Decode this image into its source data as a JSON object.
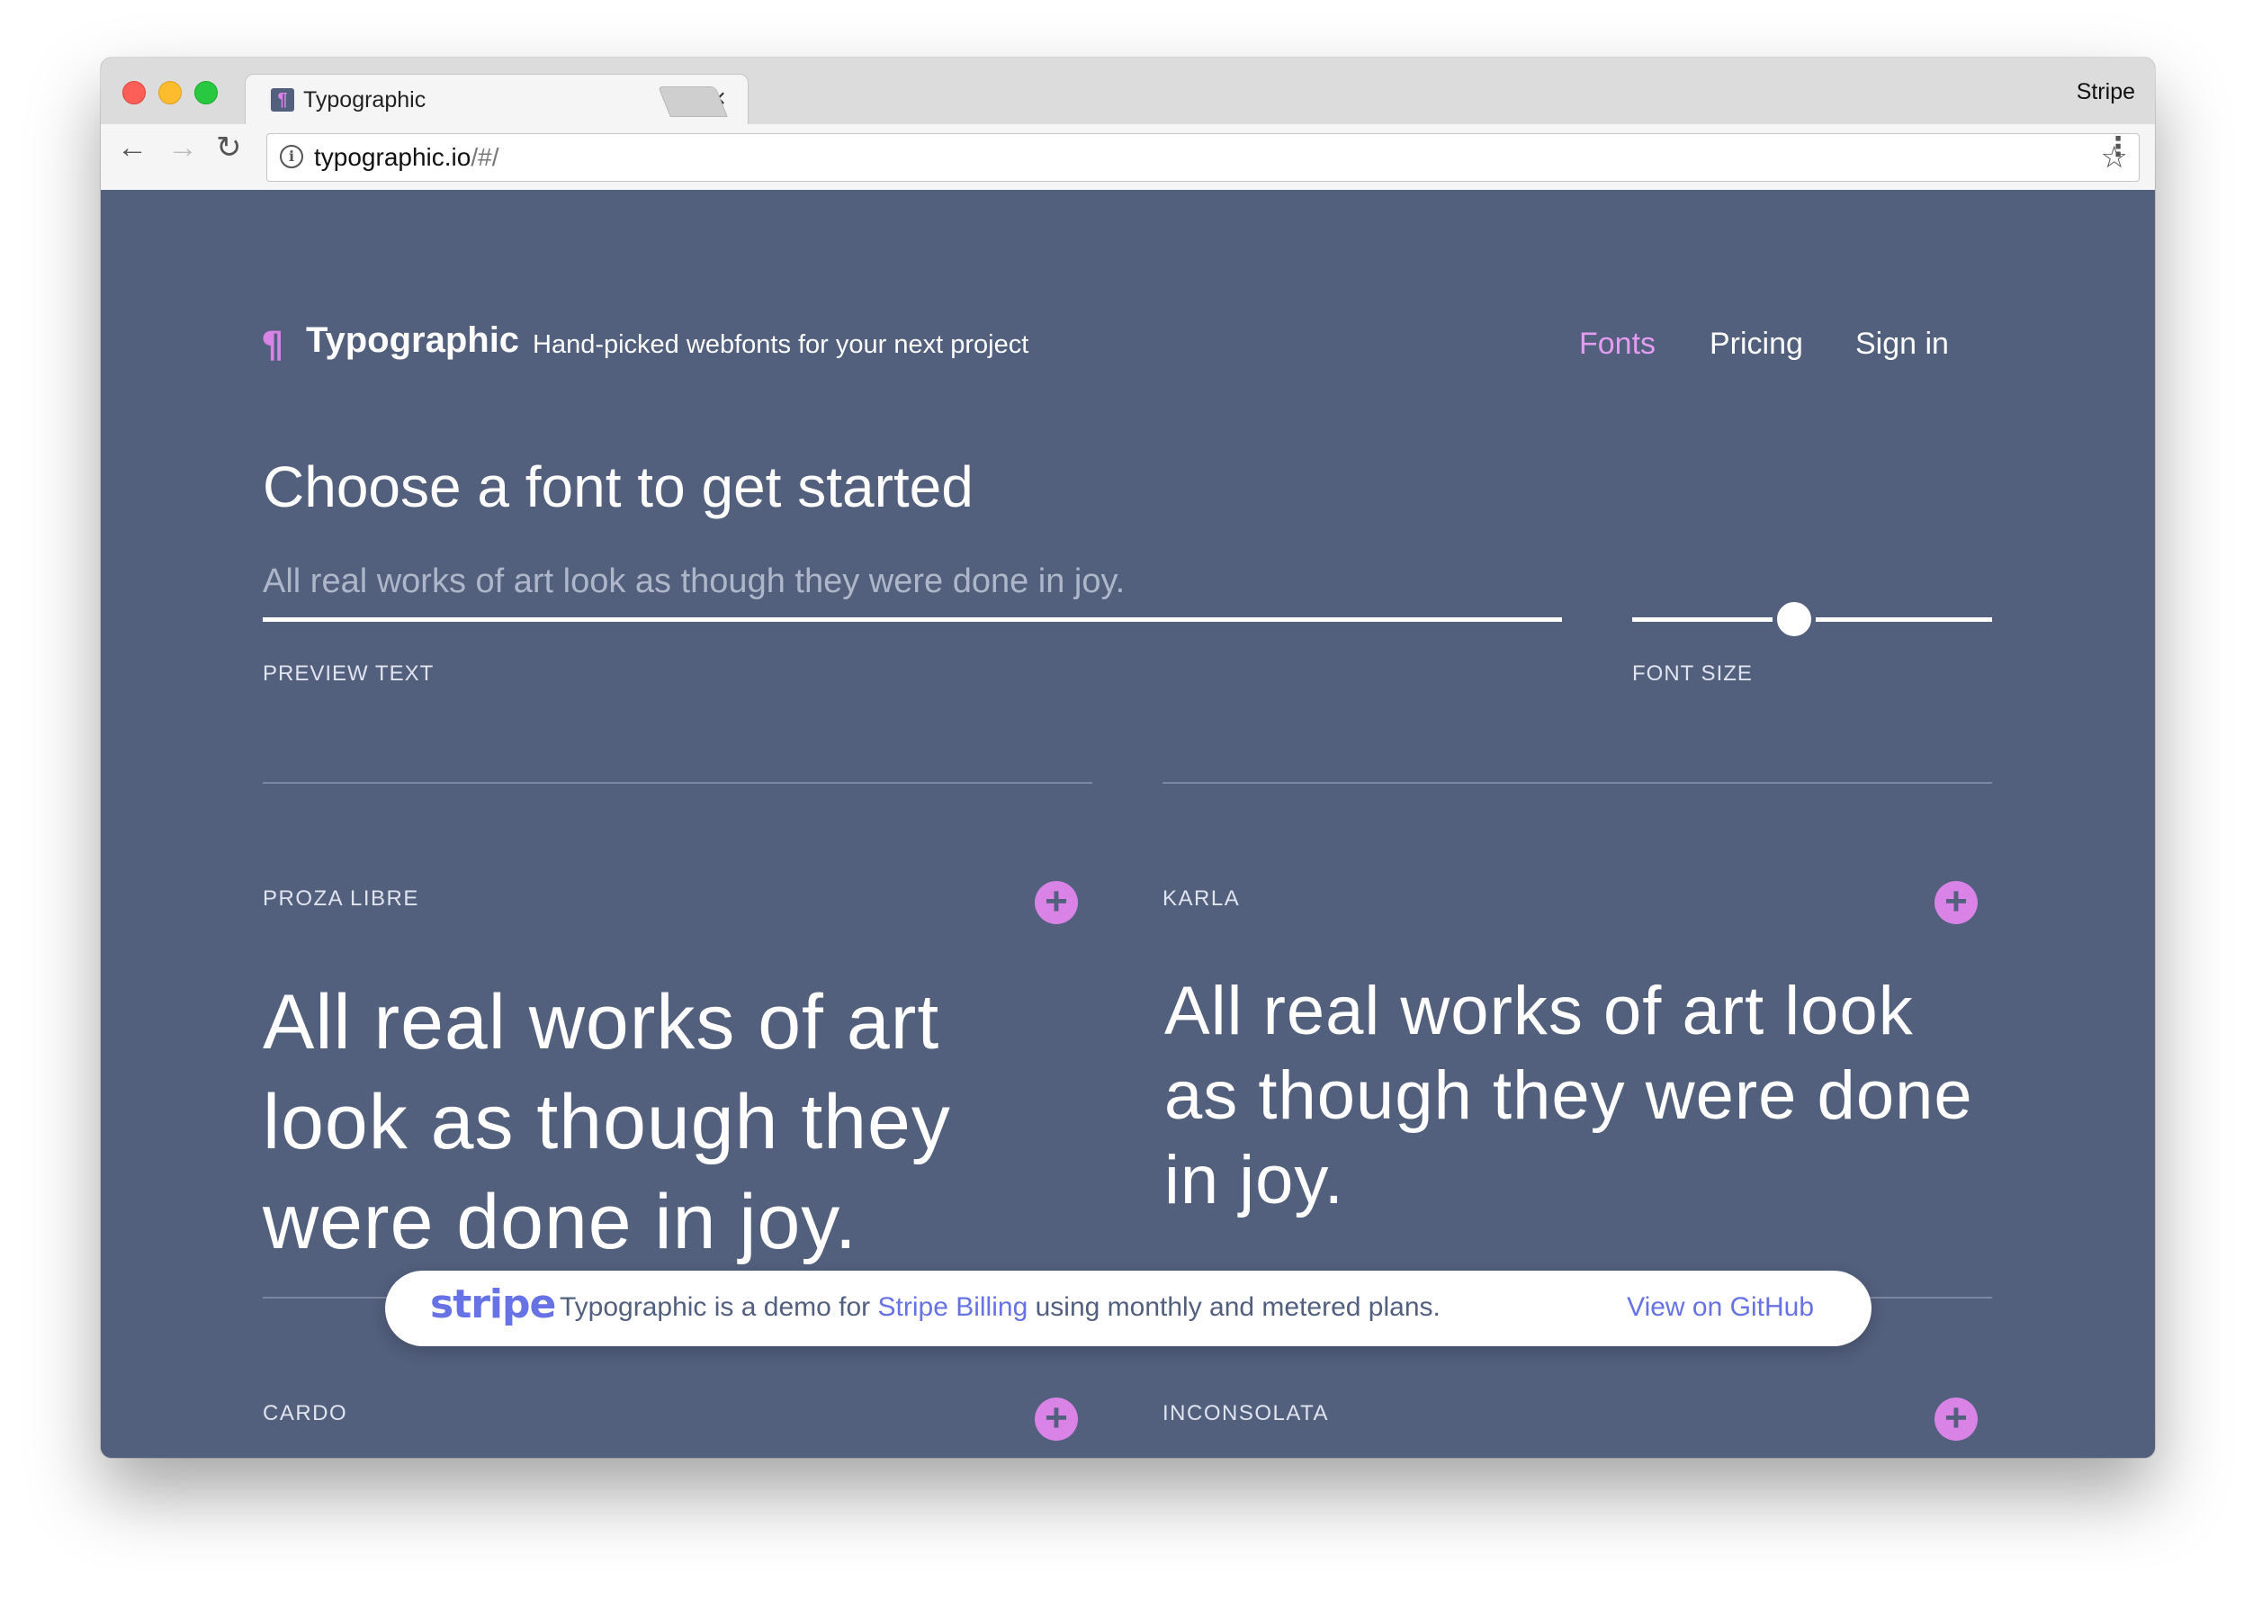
{
  "browser": {
    "tab_title": "Typographic",
    "tab_close": "×",
    "profile_name": "Stripe",
    "url_host": "typographic.io",
    "url_path": "/#/"
  },
  "header": {
    "brand_mark": "¶",
    "brand_name": "Typographic",
    "tagline": "Hand-picked webfonts for your next project",
    "nav": {
      "fonts": "Fonts",
      "pricing": "Pricing",
      "signin": "Sign in"
    }
  },
  "main": {
    "headline": "Choose a font to get started",
    "preview_placeholder": "All real works of art look as though they were done in joy.",
    "preview_label": "PREVIEW TEXT",
    "font_size_label": "FONT SIZE",
    "font_size_level": 0.45
  },
  "fonts": [
    {
      "name": "PROZA LIBRE",
      "sample": "All real works of art look as though they were done in joy."
    },
    {
      "name": "KARLA",
      "sample": "All real works of art look as though they were done in joy."
    },
    {
      "name": "CARDO"
    },
    {
      "name": "INCONSOLATA"
    }
  ],
  "stripe_banner": {
    "logo": "stripe",
    "text_before": "Typographic is a demo for ",
    "link": "Stripe Billing",
    "text_after": " using monthly and metered plans.",
    "github_link": "View on GitHub"
  },
  "colors": {
    "page_bg": "#525f7d",
    "accent": "#d883e5",
    "stripe": "#6772e5"
  }
}
